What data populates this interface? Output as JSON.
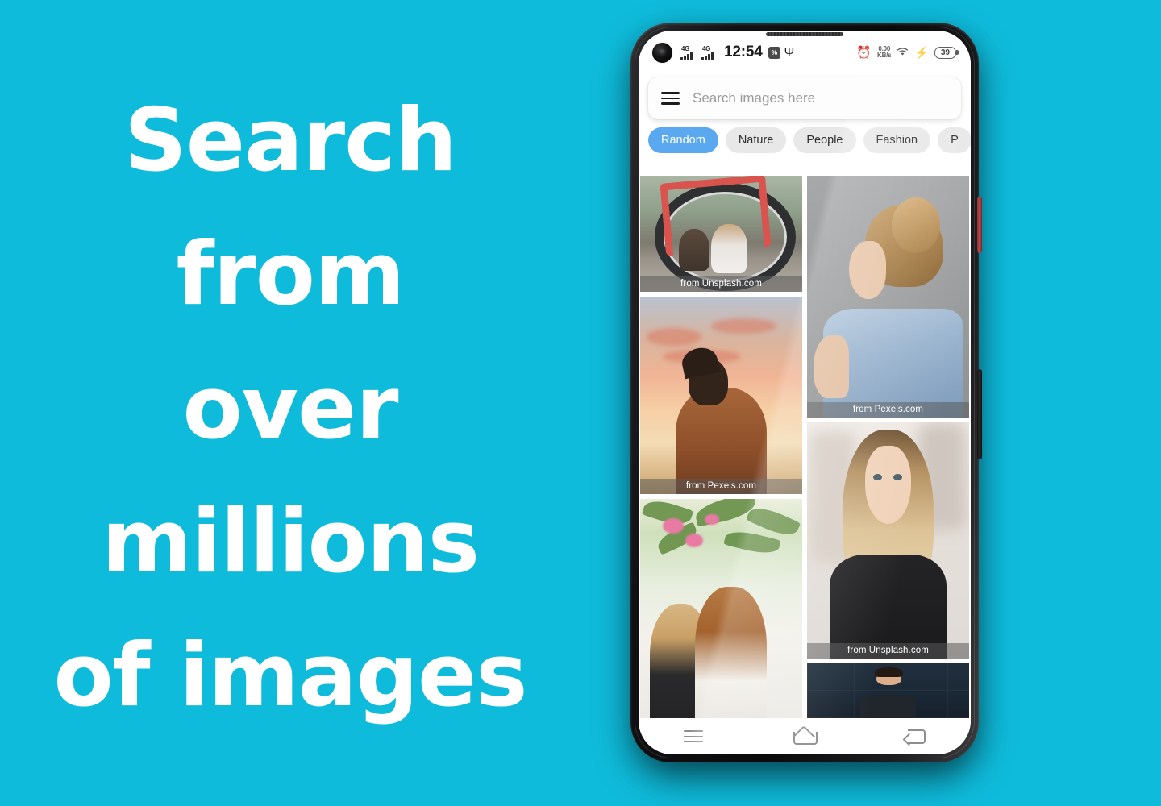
{
  "background_color": "#0FBBDB",
  "headline": {
    "lines": [
      "Search",
      "from",
      "over",
      "millions",
      "of images"
    ],
    "color": "#FFFFFF"
  },
  "phone": {
    "status_bar": {
      "network_1": "4G",
      "network_2": "4G",
      "time": "12:54",
      "vibrate_label": "%",
      "usb_icon": "Ψ",
      "alarm_icon": "⏰",
      "net_speed_value": "0.00",
      "net_speed_unit": "KB/s",
      "wifi_icon": "◡",
      "charging_icon": "⚡",
      "battery_level": "39"
    },
    "search": {
      "placeholder": "Search images here",
      "value": "",
      "menu_icon": "hamburger-menu-icon"
    },
    "chips": [
      {
        "label": "Random",
        "active": true
      },
      {
        "label": "Nature",
        "active": false
      },
      {
        "label": "People",
        "active": false
      },
      {
        "label": "Fashion",
        "active": false
      },
      {
        "label": "P",
        "active": false
      }
    ],
    "chip_active_color": "#5AA9F0",
    "chip_inactive_color": "#E8E8E8",
    "grid": {
      "left_column": [
        {
          "credit": "from Unsplash.com",
          "alt": "two people behind a red bicycle wheel on a road"
        },
        {
          "credit": "from Pexels.com",
          "alt": "woman looking up at an orange sunset sky"
        },
        {
          "credit": "",
          "alt": "two girls with long hair under pink flowers"
        }
      ],
      "right_column": [
        {
          "credit": "from Pexels.com",
          "alt": "woman with messy hair bun in a denim jacket on grey wall"
        },
        {
          "credit": "from Unsplash.com",
          "alt": "blonde woman in a black t-shirt"
        },
        {
          "credit": "",
          "alt": "man with glasses against a dark blue brick wall"
        }
      ]
    },
    "nav_bar": {
      "recents": "recents-icon",
      "home": "home-icon",
      "back": "back-icon"
    }
  }
}
